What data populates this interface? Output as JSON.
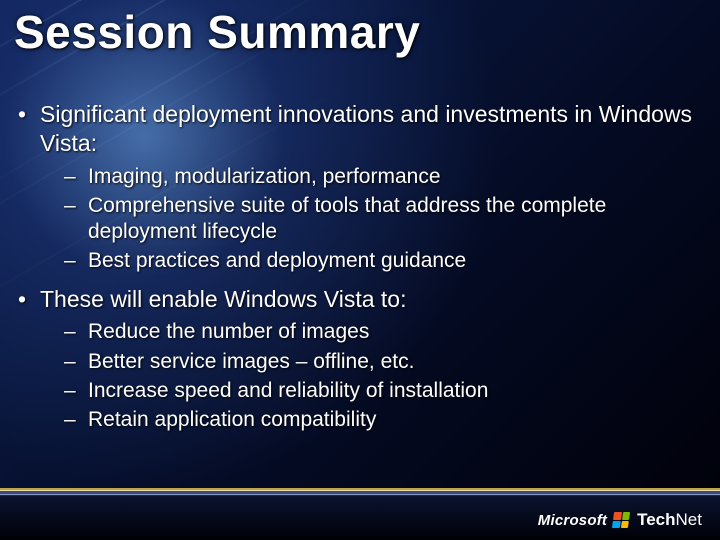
{
  "title": "Session Summary",
  "bullets": {
    "b1": {
      "text": "Significant deployment innovations and investments in Windows Vista:",
      "sub": [
        "Imaging, modularization, performance",
        "Comprehensive suite of tools that address the complete deployment lifecycle",
        "Best practices and deployment guidance"
      ]
    },
    "b2": {
      "text": "These will enable Windows Vista to:",
      "sub": [
        "Reduce the number of images",
        "Better service images – offline, etc.",
        "Increase speed and reliability of installation",
        "Retain application compatibility"
      ]
    }
  },
  "logo": {
    "company": "Microsoft",
    "brand_bold": "Tech",
    "brand_light": "Net"
  }
}
